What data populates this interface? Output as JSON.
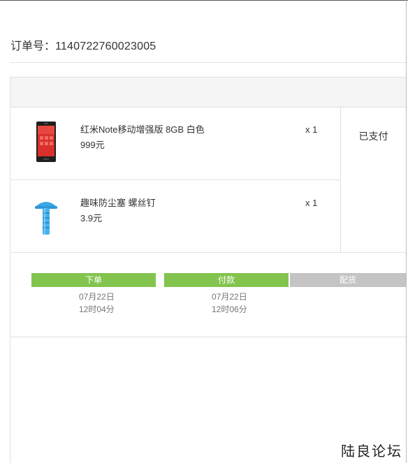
{
  "order": {
    "label": "订单号：",
    "number": "1140722760023005"
  },
  "items": [
    {
      "name": "红米Note移动增强版  8GB 白色",
      "price": "999元",
      "qty": "x 1",
      "icon": "red-phone-icon"
    },
    {
      "name": "趣味防尘塞  螺丝钉",
      "price": "3.9元",
      "qty": "x 1",
      "icon": "blue-screw-plug-icon"
    }
  ],
  "status": "已支付",
  "progress": [
    {
      "label": "下单",
      "date": "07月22日",
      "time": "12时04分",
      "done": true
    },
    {
      "label": "付款",
      "date": "07月22日",
      "time": "12时06分",
      "done": true
    },
    {
      "label": "配货",
      "date": "",
      "time": "",
      "done": false
    }
  ],
  "colors": {
    "step_done": "#83c44e",
    "step_todo": "#c4c4c4"
  },
  "watermark": "陆良论坛"
}
